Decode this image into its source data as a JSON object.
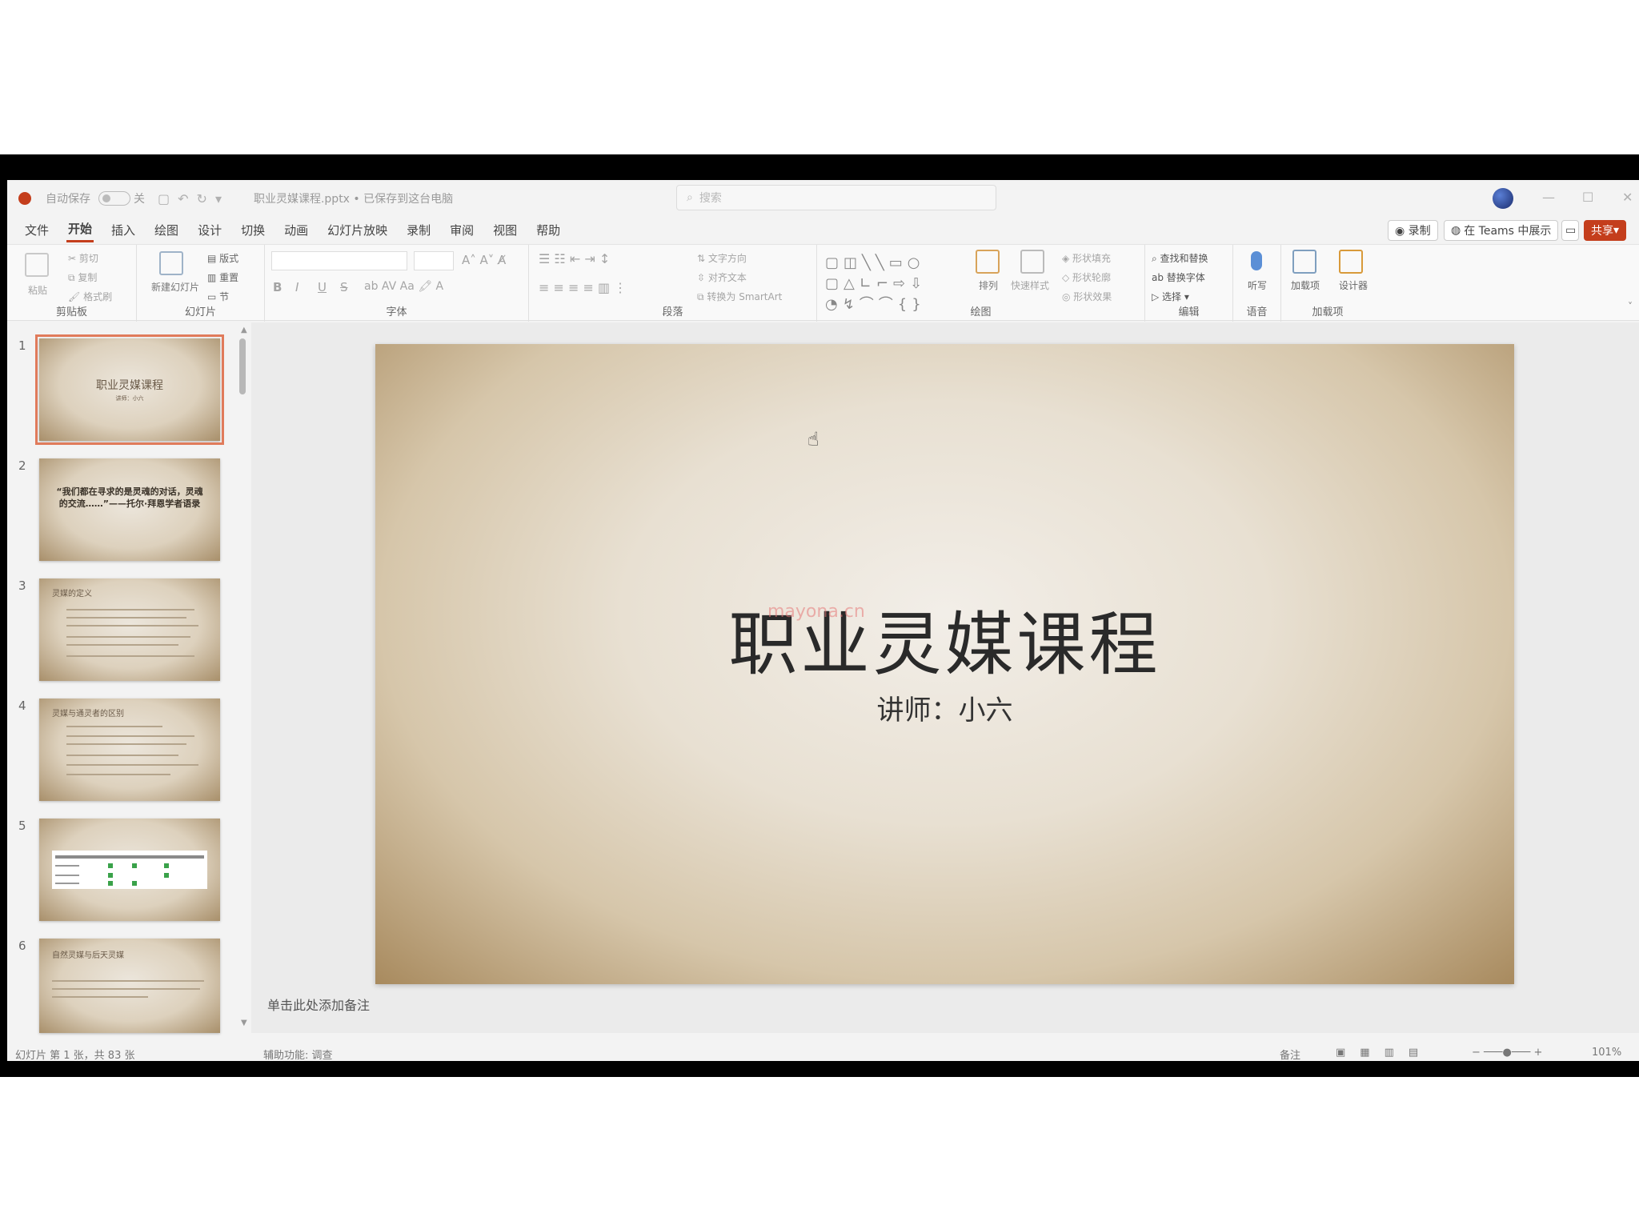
{
  "titlebar": {
    "autosave_label": "自动保存",
    "autosave_state": "关",
    "filename": "职业灵媒课程.pptx • 已保存到这台电脑",
    "search_placeholder": "搜索",
    "minimize": "—",
    "maximize": "☐",
    "close": "✕"
  },
  "tabs": [
    "文件",
    "开始",
    "插入",
    "绘图",
    "设计",
    "切换",
    "动画",
    "幻灯片放映",
    "录制",
    "审阅",
    "视图",
    "帮助"
  ],
  "active_tab": "开始",
  "right_buttons": {
    "record": "◉ 录制",
    "teams": "在 Teams 中展示",
    "share": "共享"
  },
  "ribbon": {
    "clipboard": {
      "label": "剪贴板",
      "paste": "粘贴",
      "cut": "剪切",
      "copy": "复制",
      "format_painter": "格式刷"
    },
    "slides": {
      "label": "幻灯片",
      "new_slide": "新建幻灯片",
      "layout": "版式",
      "reset": "重置",
      "section": "节"
    },
    "font": {
      "label": "字体",
      "bold": "B",
      "italic": "I",
      "underline": "U",
      "strike": "S"
    },
    "paragraph": {
      "label": "段落",
      "text_direction": "文字方向",
      "align_text": "对齐文本",
      "smartart": "转换为 SmartArt"
    },
    "drawing": {
      "label": "绘图",
      "arrange": "排列",
      "quick_styles": "快速样式",
      "shape_fill": "形状填充",
      "shape_outline": "形状轮廓",
      "shape_effects": "形状效果"
    },
    "editing": {
      "label": "编辑",
      "find": "查找和替换",
      "replace": "替换字体",
      "select": "选择"
    },
    "voice": {
      "label": "语音",
      "dictate": "听写"
    },
    "addins": {
      "label": "加载项",
      "addins_btn": "加载项",
      "designer": "设计器"
    }
  },
  "thumbnails": [
    {
      "num": "1",
      "title": "职业灵媒课程",
      "sub": "讲师：小六"
    },
    {
      "num": "2",
      "quote": "“我们都在寻求的是灵魂的对话，灵魂的交流……”——托尔·拜恩学者语录"
    },
    {
      "num": "3",
      "title": "灵媒的定义"
    },
    {
      "num": "4",
      "title": "灵媒与通灵者的区别"
    },
    {
      "num": "5"
    },
    {
      "num": "6",
      "title": "自然灵媒与后天灵媒"
    }
  ],
  "slide": {
    "title": "职业灵媒课程",
    "subtitle": "讲师：小六",
    "watermark": "mayona.cn"
  },
  "notes_placeholder": "单击此处添加备注",
  "status": {
    "slide_count": "幻灯片 第 1 张，共 83 张",
    "accessibility": "辅助功能: 调查",
    "notes": "备注",
    "zoom": "101%"
  }
}
